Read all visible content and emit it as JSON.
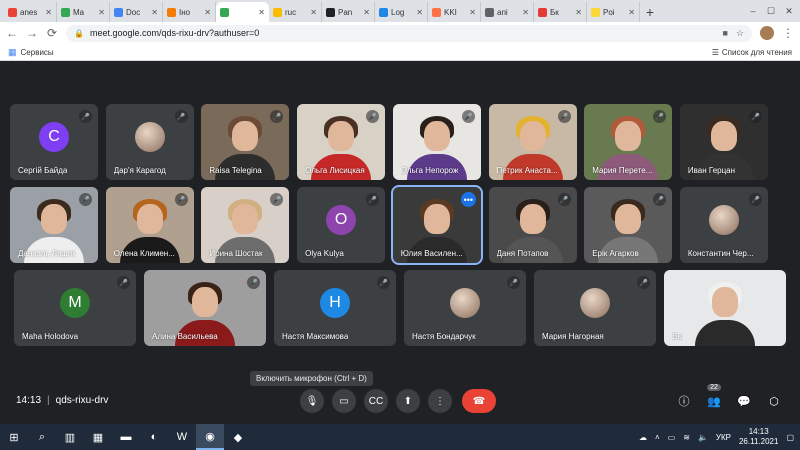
{
  "browser": {
    "tabs": [
      {
        "label": "anes",
        "color": "#ea4335",
        "active": false
      },
      {
        "label": "Ma",
        "color": "#34a853",
        "active": false
      },
      {
        "label": "Doc",
        "color": "#4285f4",
        "active": false
      },
      {
        "label": "Іно",
        "color": "#f57c00",
        "active": false
      },
      {
        "label": "",
        "color": "#34a853",
        "active": true
      },
      {
        "label": "ruc",
        "color": "#fbbc04",
        "active": false
      },
      {
        "label": "Pan",
        "color": "#202124",
        "active": false
      },
      {
        "label": "Log",
        "color": "#1e88e5",
        "active": false
      },
      {
        "label": "KKI",
        "color": "#ff7043",
        "active": false
      },
      {
        "label": "ani",
        "color": "#5f6368",
        "active": false
      },
      {
        "label": "Бк",
        "color": "#e53935",
        "active": false
      },
      {
        "label": "Poi",
        "color": "#fdd835",
        "active": false
      }
    ],
    "url": "meet.google.com/qds-rixu-drv?authuser=0",
    "bookmarks_label": "Сервисы",
    "reading_list": "Список для чтения"
  },
  "participants": [
    {
      "name": "Сергій Байда",
      "type": "initial",
      "initial": "С",
      "color": "#7e3ff2"
    },
    {
      "name": "Дар'я Карагод",
      "type": "photo"
    },
    {
      "name": "Raisa Telegina",
      "type": "video",
      "hair": "#6b4a36",
      "body": "#2d2d2d",
      "bg": "#7a6a5a"
    },
    {
      "name": "Ольга Лисицкая",
      "type": "video",
      "hair": "#4a3022",
      "body": "#c62828",
      "bg": "#d8d2c6"
    },
    {
      "name": "Ольга Непорож",
      "type": "video",
      "hair": "#2a1f1a",
      "body": "#5b3b8a",
      "bg": "#e8e6e2"
    },
    {
      "name": "Петрик Анаста...",
      "type": "video",
      "hair": "#e3b22e",
      "body": "#c0392b",
      "bg": "#c8b8a6"
    },
    {
      "name": "Мария Перете...",
      "type": "video",
      "hair": "#b05a3a",
      "body": "#8d5a7a",
      "bg": "#6a7a50"
    },
    {
      "name": "Иван Герцан",
      "type": "video",
      "hair": "#3a2a20",
      "body": "#333",
      "bg": "#2f2f2f"
    },
    {
      "name": "Даниэль Ляшик",
      "type": "video",
      "hair": "#3b2a1e",
      "body": "#eeeeee",
      "bg": "#9aa0a6"
    },
    {
      "name": "Олена Климен...",
      "type": "video",
      "hair": "#b5651d",
      "body": "#1a1a1a",
      "bg": "#b0a090"
    },
    {
      "name": "Ирина Шостак",
      "type": "video",
      "hair": "#d0b080",
      "body": "#6d6d6d",
      "bg": "#d8d0c8"
    },
    {
      "name": "Olya Kulya",
      "type": "initial",
      "initial": "O",
      "color": "#8e44ad"
    },
    {
      "name": "Юлия Василен...",
      "type": "video",
      "hair": "#5a3a22",
      "body": "#2a2a2a",
      "bg": "#3a3a3a",
      "active": true
    },
    {
      "name": "Даня Потапов",
      "type": "video",
      "hair": "#2a1e18",
      "body": "#555",
      "bg": "#4a4a4a"
    },
    {
      "name": "Ерік Агарков",
      "type": "video",
      "hair": "#3a2a1e",
      "body": "#777",
      "bg": "#5a5a5a"
    },
    {
      "name": "Константин Чер...",
      "type": "photo"
    },
    {
      "name": "Maha Holodova",
      "type": "initial",
      "initial": "M",
      "color": "#2e7d32"
    },
    {
      "name": "Алина Васильева",
      "type": "video",
      "hair": "#3a2216",
      "body": "#8b1a1a",
      "bg": "#9e9e9e"
    },
    {
      "name": "Настя Максимова",
      "type": "initial",
      "initial": "Н",
      "color": "#1e88e5"
    },
    {
      "name": "Настя Бондарчук",
      "type": "photo"
    },
    {
      "name": "Мария Нагорная",
      "type": "photo"
    },
    {
      "name": "Вы",
      "type": "video",
      "hair": "#f0f0f0",
      "body": "#2a2a2a",
      "bg": "#e6e8ea"
    }
  ],
  "tooltip": "Включить микрофон (Ctrl + D)",
  "meeting": {
    "time": "14:13",
    "separator": "|",
    "code": "qds-rixu-drv"
  },
  "people_count": "22",
  "taskbar": {
    "lang": "УКР",
    "time": "14:13",
    "date": "26.11.2021"
  }
}
